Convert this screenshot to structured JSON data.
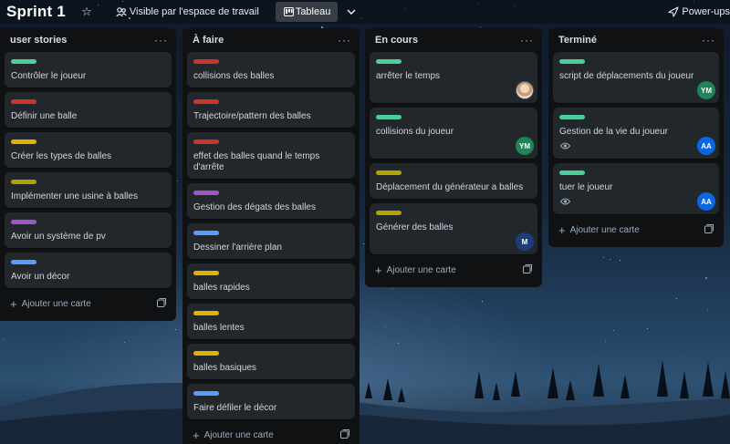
{
  "header": {
    "board_title": "Sprint 1",
    "star_icon": "star-outline-icon",
    "visibility_label": "Visible par l'espace de travail",
    "view_label": "Tableau",
    "powerups_label": "Power-ups"
  },
  "lists": [
    {
      "title": "user stories",
      "add_label": "Ajouter une carte",
      "cards": [
        {
          "title": "Contrôler le joueur",
          "label_color": "#4bce97"
        },
        {
          "title": "Définir une balle",
          "label_color": "#c9372c"
        },
        {
          "title": "Créer les types de balles",
          "label_color": "#e2b203"
        },
        {
          "title": "Implémenter une usine à balles",
          "label_color": "#b3a300"
        },
        {
          "title": "Avoir un système de pv",
          "label_color": "#9f57c7"
        },
        {
          "title": "Avoir un décor",
          "label_color": "#579dff"
        }
      ]
    },
    {
      "title": "À faire",
      "add_label": "Ajouter une carte",
      "cards": [
        {
          "title": "collisions des balles",
          "label_color": "#c9372c"
        },
        {
          "title": "Trajectoire/pattern des balles",
          "label_color": "#c9372c"
        },
        {
          "title": "effet des balles quand le temps d'arrête",
          "label_color": "#c9372c"
        },
        {
          "title": "Gestion des dégats des balles",
          "label_color": "#9f57c7"
        },
        {
          "title": "Dessiner l'arrière plan",
          "label_color": "#579dff"
        },
        {
          "title": "balles rapides",
          "label_color": "#e2b203"
        },
        {
          "title": "balles lentes",
          "label_color": "#e2b203"
        },
        {
          "title": "balles basiques",
          "label_color": "#e2b203"
        },
        {
          "title": "Faire défiler le décor",
          "label_color": "#579dff"
        }
      ]
    },
    {
      "title": "En cours",
      "add_label": "Ajouter une carte",
      "cards": [
        {
          "title": "arrêter le temps",
          "label_color": "#4bce97",
          "avatar": "photo"
        },
        {
          "title": "collisions du joueur",
          "label_color": "#4bce97",
          "avatar": "YM"
        },
        {
          "title": "Déplacement du générateur a balles",
          "label_color": "#b3a300"
        },
        {
          "title": "Générer des balles",
          "label_color": "#b3a300",
          "avatar": "M"
        }
      ]
    },
    {
      "title": "Terminé",
      "add_label": "Ajouter une carte",
      "cards": [
        {
          "title": "script de déplacements du joueur",
          "label_color": "#4bce97",
          "avatar": "YM"
        },
        {
          "title": "Gestion de la vie du joueur",
          "label_color": "#4bce97",
          "avatar": "AA",
          "watch": true
        },
        {
          "title": "tuer le joueur",
          "label_color": "#4bce97",
          "avatar": "AA",
          "watch": true
        }
      ]
    }
  ],
  "colors": {
    "green_label": "#4bce97",
    "red_label": "#c9372c",
    "orange_label": "#e2b203",
    "olive_label": "#b3a300",
    "purple_label": "#9f57c7",
    "blue_label": "#579dff",
    "avatar_ym": "#1f845a",
    "avatar_aa": "#0c66e4",
    "avatar_m": "#1d3d78"
  }
}
